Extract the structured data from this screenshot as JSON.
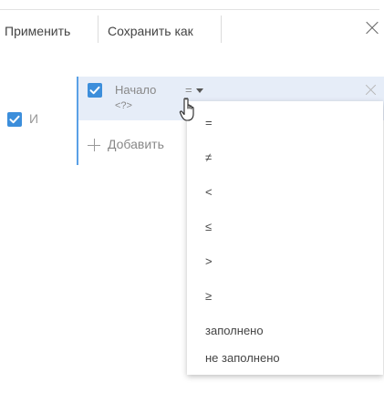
{
  "toolbar": {
    "apply_label": "Применить",
    "save_as_label": "Сохранить как"
  },
  "group": {
    "logic_label": "И",
    "logic_checked": true
  },
  "condition": {
    "checked": true,
    "field_name": "Начало",
    "operator": "=",
    "value": "<?>"
  },
  "add": {
    "label": "Добавить"
  },
  "operator_menu": {
    "items": [
      "=",
      "≠",
      "<",
      "≤",
      ">",
      "≥",
      "заполнено",
      "не заполнено"
    ]
  },
  "colors": {
    "accent": "#3c8edb",
    "row_highlight": "#e6edf8",
    "group_bar": "#5aa0e6"
  },
  "icons": [
    "close-icon",
    "checkbox-icon",
    "plus-icon",
    "chevron-down-icon",
    "hand-cursor-icon"
  ]
}
